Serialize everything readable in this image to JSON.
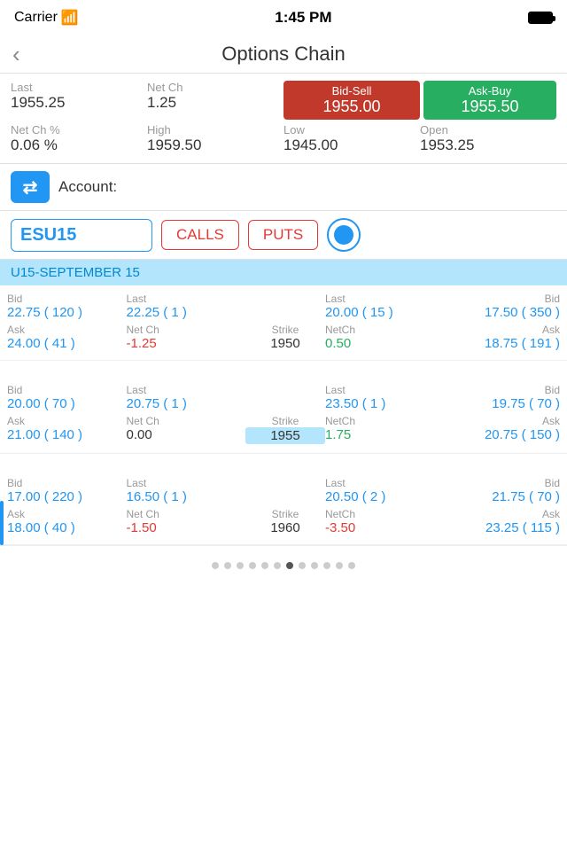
{
  "statusBar": {
    "carrier": "Carrier",
    "wifi": "📶",
    "time": "1:45 PM",
    "battery": "full"
  },
  "header": {
    "back": "<",
    "title": "Options Chain"
  },
  "quote": {
    "last_label": "Last",
    "last_val": "1955.25",
    "netch_label": "Net Ch",
    "netch_val": "1.25",
    "bid_sell_label": "Bid-Sell",
    "bid_sell_val": "1955.00",
    "ask_buy_label": "Ask-Buy",
    "ask_buy_val": "1955.50",
    "netchpct_label": "Net Ch %",
    "netchpct_val": "0.06 %",
    "high_label": "High",
    "high_val": "1959.50",
    "low_label": "Low",
    "low_val": "1945.00",
    "open_label": "Open",
    "open_val": "1953.25"
  },
  "account": {
    "label": "Account:"
  },
  "toolbar": {
    "symbol": "ESU15",
    "calls_label": "CALLS",
    "puts_label": "PUTS"
  },
  "monthHeader": "U15-SEPTEMBER 15",
  "rows": [
    {
      "left_bid_label": "Bid",
      "left_bid_val": "22.75 ( 120 )",
      "left_last_label": "Last",
      "left_last_val": "22.25 ( 1 )",
      "right_last_label": "Last",
      "right_last_val": "20.00 ( 15 )",
      "right_bid_label": "Bid",
      "right_bid_val": "17.50 ( 350 )",
      "left_ask_label": "Ask",
      "left_ask_val": "24.00 ( 41 )",
      "netch_label": "Net Ch",
      "netch_val": "-1.25",
      "netch_type": "neg",
      "strike_label": "Strike",
      "strike_val": "1950",
      "strike_highlight": false,
      "right_netch_label": "NetCh",
      "right_netch_val": "0.50",
      "right_netch_type": "pos",
      "right_ask_label": "Ask",
      "right_ask_val": "18.75 ( 191 )"
    },
    {
      "left_bid_label": "Bid",
      "left_bid_val": "20.00 ( 70 )",
      "left_last_label": "Last",
      "left_last_val": "20.75 ( 1 )",
      "right_last_label": "Last",
      "right_last_val": "23.50 ( 1 )",
      "right_bid_label": "Bid",
      "right_bid_val": "19.75 ( 70 )",
      "left_ask_label": "Ask",
      "left_ask_val": "21.00 ( 140 )",
      "netch_label": "Net Ch",
      "netch_val": "0.00",
      "netch_type": "normal",
      "strike_label": "Strike",
      "strike_val": "1955",
      "strike_highlight": true,
      "right_netch_label": "NetCh",
      "right_netch_val": "1.75",
      "right_netch_type": "pos",
      "right_ask_label": "Ask",
      "right_ask_val": "20.75 ( 150 )"
    },
    {
      "left_bid_label": "Bid",
      "left_bid_val": "17.00 ( 220 )",
      "left_last_label": "Last",
      "left_last_val": "16.50 ( 1 )",
      "right_last_label": "Last",
      "right_last_val": "20.50 ( 2 )",
      "right_bid_label": "Bid",
      "right_bid_val": "21.75 ( 70 )",
      "left_ask_label": "Ask",
      "left_ask_val": "18.00 ( 40 )",
      "netch_label": "Net Ch",
      "netch_val": "-1.50",
      "netch_type": "neg",
      "strike_label": "Strike",
      "strike_val": "1960",
      "strike_highlight": false,
      "right_netch_label": "NetCh",
      "right_netch_val": "-3.50",
      "right_netch_type": "neg",
      "right_ask_label": "Ask",
      "right_ask_val": "23.25 ( 115 )"
    }
  ],
  "scrollDots": [
    "",
    "",
    "",
    "",
    "",
    "",
    "",
    "",
    "",
    "",
    "",
    ""
  ],
  "activeScrollDot": 6
}
